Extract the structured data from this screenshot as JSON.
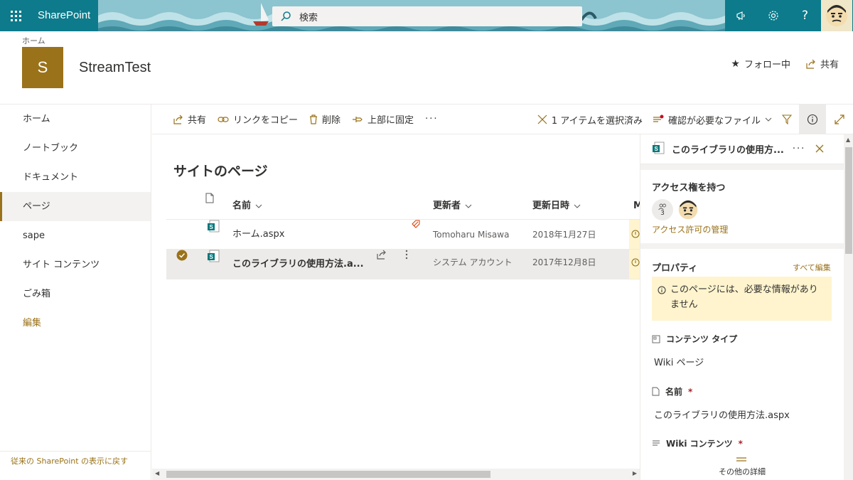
{
  "suitebar": {
    "brand": "SharePoint",
    "search_placeholder": "検索",
    "icons": [
      "waffle-icon",
      "megaphone-icon",
      "gear-icon",
      "help-icon",
      "user-avatar-icon"
    ],
    "help": "?"
  },
  "site": {
    "breadcrumb": "ホーム",
    "logo_letter": "S",
    "title": "StreamTest",
    "follow_label": "フォロー中",
    "share_label": "共有"
  },
  "nav": {
    "items": [
      "ホーム",
      "ノートブック",
      "ドキュメント",
      "ページ",
      "sape",
      "サイト コンテンツ",
      "ごみ箱"
    ],
    "selected": "ページ",
    "edit_label": "編集",
    "classic_link": "従来の SharePoint の表示に戻す"
  },
  "commandbar": {
    "share": "共有",
    "copy_link": "リンクをコピー",
    "delete": "削除",
    "pin_top": "上部に固定",
    "more": "···",
    "selection": "1 アイテムを選択済み",
    "view_name": "確認が必要なファイル"
  },
  "library": {
    "heading": "サイトのページ",
    "columns": {
      "name": "名前",
      "modified_by": "更新者",
      "modified": "更新日時",
      "extra": "M"
    },
    "rows": [
      {
        "name": "ホーム.aspx",
        "modified_by": "Tomoharu Misawa",
        "modified": "2018年1月27日",
        "selected": false
      },
      {
        "name": "このライブラリの使用方法.a...",
        "modified_by": "システム アカウント",
        "modified": "2017年12月8日",
        "selected": true
      }
    ]
  },
  "details_panel": {
    "title": "このライブラリの使用方...",
    "more": "···",
    "access_heading": "アクセス権を持つ",
    "access_count": "3",
    "manage_access": "アクセス許可の管理",
    "properties_heading": "プロパティ",
    "edit_all": "すべて編集",
    "notice": "このページには、必要な情報がありません",
    "content_type_label": "コンテンツ タイプ",
    "content_type_value": "Wiki ページ",
    "name_label": "名前",
    "name_value": "このライブラリの使用方法.aspx",
    "wiki_label": "Wiki コンテンツ",
    "required_mark": "*",
    "more_details": "その他の詳細"
  },
  "colors": {
    "accent": "#9a7219",
    "suitebar": "#0d7b8b",
    "notice_bg": "#fff4ce"
  }
}
